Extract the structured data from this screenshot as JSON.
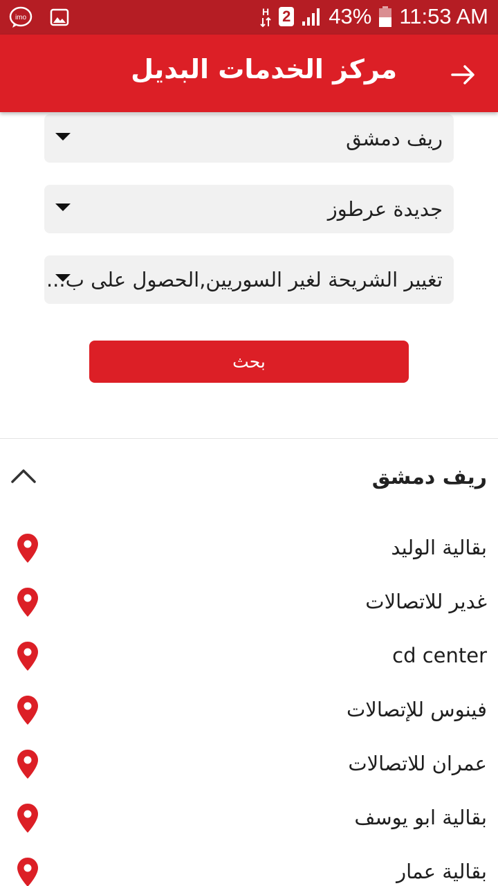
{
  "status_bar": {
    "battery": "43%",
    "time": "11:53 AM",
    "sim": "2",
    "icons": [
      "imo-icon",
      "gallery-icon",
      "data-h-icon",
      "sim-2-icon",
      "signal-icon",
      "battery-icon"
    ]
  },
  "app_bar": {
    "title": "مركز الخدمات البديل",
    "back_icon": "arrow-right-icon"
  },
  "filters": {
    "governorate": "ريف دمشق",
    "area": "جديدة عرطوز",
    "service": "تغيير الشريحة لغير السوريين,الحصول على ب..."
  },
  "search_button": "بحث",
  "results": {
    "region": "ريف دمشق",
    "items": [
      "بقالية الوليد",
      "غدير للاتصالات",
      "cd center",
      "فينوس للإتصالات",
      "عمران للاتصالات",
      "بقالية ابو يوسف",
      "بقالية عمار"
    ]
  },
  "colors": {
    "status_bar": "#b51d24",
    "app_bar": "#dc1f26",
    "accent": "#dc1f26",
    "dropdown_bg": "#f1f1f1"
  }
}
